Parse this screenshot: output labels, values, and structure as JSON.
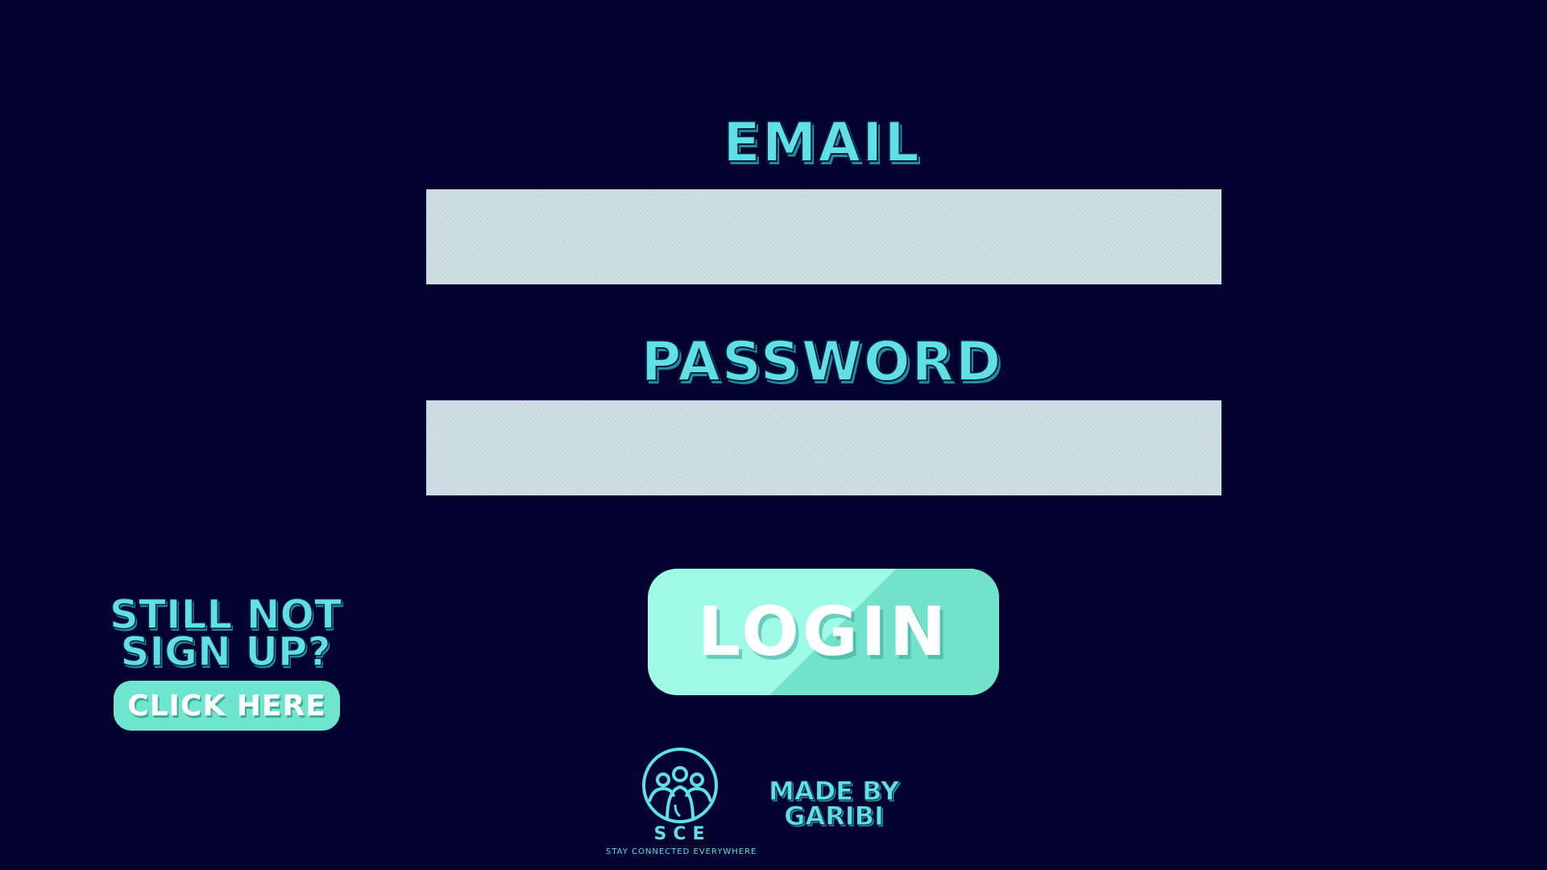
{
  "login_form": {
    "email_label": "EMAIL",
    "email_value": "",
    "password_label": "PASSWORD",
    "password_value": "",
    "login_button_label": "LOGIN"
  },
  "signup_promo": {
    "title": "STILL NOT SIGN UP?",
    "button_label": "CLICK HERE"
  },
  "footer": {
    "logo_icon": "people-circle-icon",
    "logo_text": "SCE",
    "logo_tagline": "STAY CONNECTED EVERYWHERE",
    "credit": "MADE BY GARIBI"
  },
  "colors": {
    "background": "#03022e",
    "accent": "#5ee0e6",
    "button": "#9ef9e6",
    "field": "#cfdfe5"
  }
}
